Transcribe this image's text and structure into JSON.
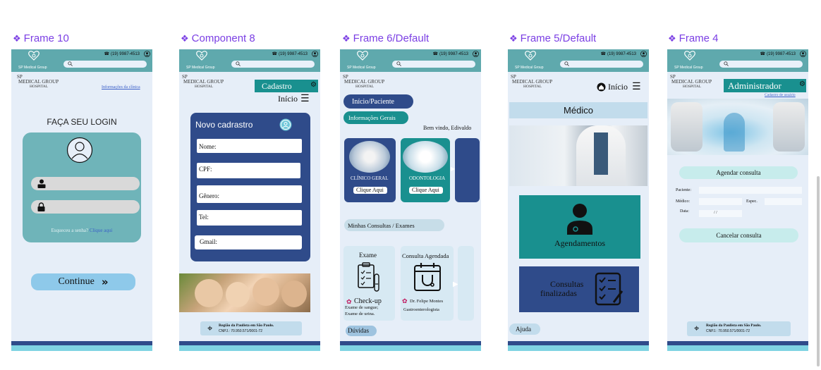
{
  "labels": {
    "f10": "Frame 10",
    "c8": "Component 8",
    "f6": "Frame 6/Default",
    "f5": "Frame 5/Default",
    "f4": "Frame 4"
  },
  "header": {
    "brand": "SP Medical Group",
    "phone": "(19) 9987-4513",
    "hosp_l1": "SP",
    "hosp_l2": "MEDICAL GROUP",
    "hosp_l3": "HOSPITAL"
  },
  "frame10": {
    "info_link": "Informações da clínica",
    "title": "FAÇA SEU LOGIN",
    "forgot": "Esqueceu a senha?",
    "click_here": "Clique aqui",
    "continue": "Continue"
  },
  "comp8": {
    "cadastro": "Cadastro",
    "inicio": "Início",
    "form_title": "Novo cadrastro",
    "fields": [
      "Nome:",
      "CPF:",
      "Gênero:",
      "Tel:",
      "Gmail:"
    ],
    "footer_l1": "Região da Paulista em São Paulo.",
    "footer_l2": "CNPJ.: 70.950.571/0001-72"
  },
  "frame6": {
    "btn1": "Início/Paciente",
    "btn2": "Informações Gerais",
    "welcome": "Bem vindo, Edivaldo",
    "card1_title": "CLÍNICO GERAL",
    "card2_title": "ODONTOLOGIA",
    "click": "Clique Aqui",
    "section": "Minhas Consultas  / Exames",
    "exam_title": "Exame",
    "exam_item": "Check-up",
    "exam_desc1": "Exame de sangue;",
    "exam_desc2": "Exame de urina.",
    "cons_title": "Consulta Agendada",
    "cons_doctor": "Dr. Felipe Montes",
    "cons_spec": "Gastroenterologista",
    "help": "Dúvidas"
  },
  "frame5": {
    "inicio": "Início",
    "title": "Médico",
    "card1": "Agendamentos",
    "card2_l1": "Consultas",
    "card2_l2": "finalizadas",
    "help": "Ajuda"
  },
  "frame4": {
    "admin": "Administrador",
    "admin_sub": "Cadastro de usuário",
    "schedule": "Agendar consulta",
    "patient": "Paciente:",
    "doctor": "Médico:",
    "spec": "Espec.",
    "date": "Data:",
    "date_sep": "/        /",
    "cancel": "Cancelar consulta",
    "footer_l1": "Região da Paulista em São Paulo.",
    "footer_l2": "CNPJ.: 70.950.571/0001-72"
  },
  "colors": {
    "teal": "#5fa9ad",
    "navy": "#2f4b8a",
    "tealDark": "#19908f",
    "accent": "#7b3fe4"
  }
}
